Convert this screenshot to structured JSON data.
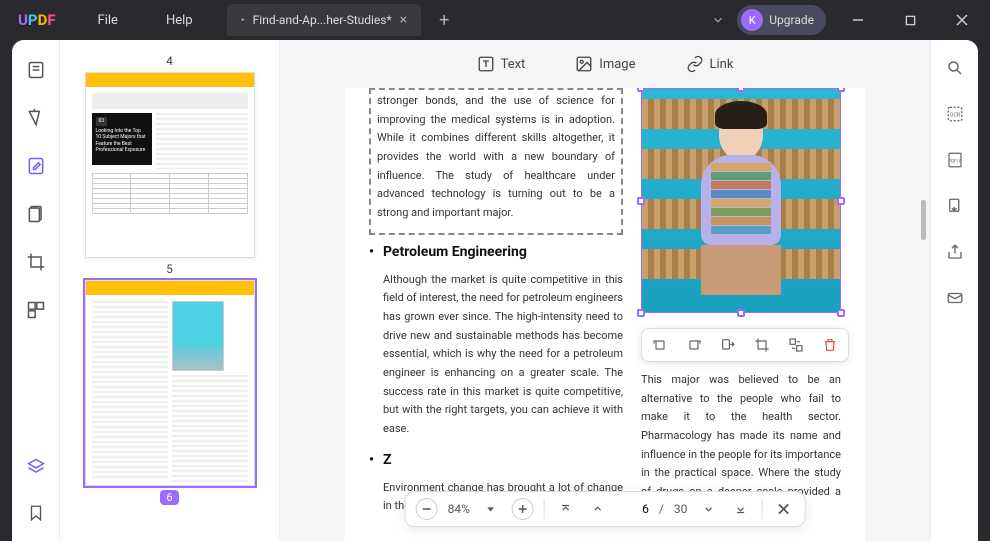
{
  "logo": {
    "u": "U",
    "p": "P",
    "d": "D",
    "f": "F"
  },
  "menu": {
    "file": "File",
    "help": "Help"
  },
  "tab": {
    "title": "Find-and-Ap...her-Studies*",
    "dirty": "•",
    "close": "×"
  },
  "upgrade": {
    "initial": "K",
    "label": "Upgrade"
  },
  "thumbs": {
    "page4_label": "4",
    "page5_label": "5",
    "page6_badge": "6",
    "blackbox_num": "03",
    "blackbox_text": "Looking Into the Top 10 Subject Majors that Feature the Best Professional Exposure"
  },
  "toolbar": {
    "text": "Text",
    "image": "Image",
    "link": "Link"
  },
  "doc": {
    "intro": "stronger bonds, and the use of science for improving the medical systems is in adoption. While it combines different skills altogether, it provides the world with a new boundary of influence. The study of healthcare under advanced technology is turning out to be a strong and important major.",
    "h1": "Petroleum Engineering",
    "p1": "Although the market is quite competitive in this field of interest, the need for petroleum engineers has grown ever since. The high-in­tensity need to drive new and sustainable methods has become essential, which is why the need for a petroleum engineer is enhancing on a greater scale. The success rate in this market is quite competitive, but with the right targets, you can achieve it with ease.",
    "h2": "Z",
    "p2": "Environment change has brought a lot of change in the dynamics of world order. To save",
    "rtext": "This major was believed to be an alternative to the people who fail to make it to the health sector. Pharmacology has made its name and influence in the people for its importance in the practical space. Where the study of drugs on a deeper scale provided a better insight, this"
  },
  "zoom": {
    "value": "84%"
  },
  "paging": {
    "current": "6",
    "sep": "/",
    "total": "30"
  },
  "books": [
    "#d4a86a",
    "#5a9e7a",
    "#c47a5a",
    "#5a8ac4",
    "#d4a86a",
    "#7a9e5a",
    "#c4945a",
    "#5a9ec4"
  ]
}
